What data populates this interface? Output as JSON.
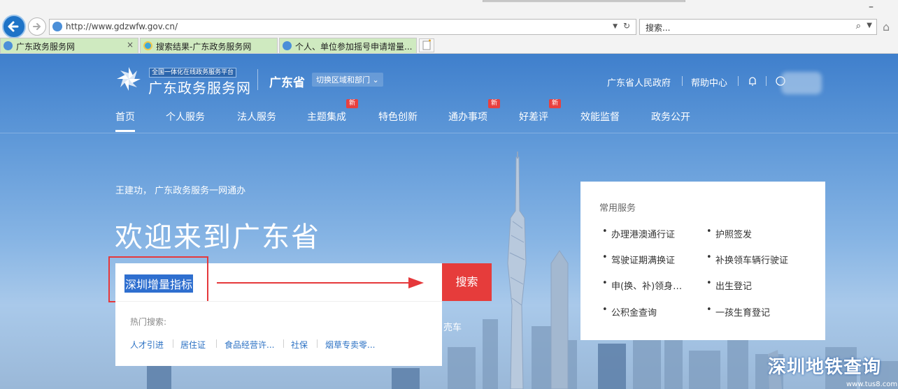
{
  "browser": {
    "url": "http://www.gdzwfw.gov.cn/",
    "search_placeholder": "搜索...",
    "tabs": [
      {
        "label": "广东政务服务网"
      },
      {
        "label": "搜索结果-广东政务服务网"
      },
      {
        "label": "个人、单位参加摇号申请增量..."
      }
    ],
    "close_glyph": "×",
    "minimize_glyph": "–",
    "refresh_glyph": "↻",
    "home_glyph": "⌂"
  },
  "header": {
    "logo_small": "全国一体化在线政务服务平台",
    "logo_main": "广东政务服务网",
    "province": "广东省",
    "switch_label": "切换区域和部门 ⌄",
    "links": [
      "广东省人民政府",
      "帮助中心"
    ]
  },
  "nav": {
    "items": [
      {
        "label": "首页",
        "new": false
      },
      {
        "label": "个人服务",
        "new": false
      },
      {
        "label": "法人服务",
        "new": false
      },
      {
        "label": "主题集成",
        "new": true
      },
      {
        "label": "特色创新",
        "new": false
      },
      {
        "label": "通办事项",
        "new": true
      },
      {
        "label": "好差评",
        "new": true
      },
      {
        "label": "效能监督",
        "new": false
      },
      {
        "label": "政务公开",
        "new": false
      }
    ],
    "new_badge": "新"
  },
  "hero": {
    "greeting": "王建功， 广东政务服务一网通办",
    "welcome": "欢迎来到广东省",
    "search_query": "深圳增量指标",
    "search_button": "搜索",
    "hot_title": "热门搜索:",
    "hot_items": [
      "人才引进",
      "居住证",
      "食品经营许...",
      "社保",
      "烟草专卖零..."
    ],
    "partial_text": "売车"
  },
  "common_services": {
    "title": "常用服务",
    "items": [
      "办理港澳通行证",
      "护照签发",
      "驾驶证期满换证",
      "补换领车辆行驶证",
      "申(换、补)领身…",
      "出生登记",
      "公积金查询",
      "一孩生育登记"
    ]
  },
  "watermark": {
    "main": "深圳地铁查询",
    "sub": "www.tus8.com"
  },
  "colors": {
    "accent": "#e63c3b",
    "site_blue": "#3f7fcc",
    "link": "#2d72c4",
    "tab_green": "#cfeac0"
  }
}
